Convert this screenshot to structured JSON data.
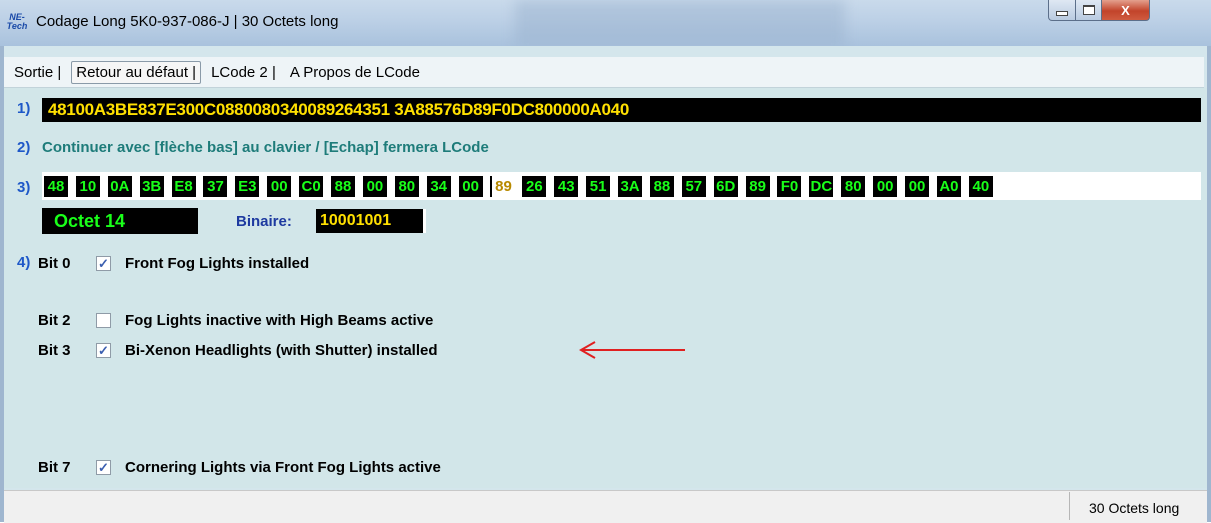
{
  "window": {
    "title": "Codage Long  5K0-937-086-J | 30 Octets long",
    "icon_text_top": "NE-",
    "icon_text_bottom": "Tech",
    "close_glyph": "X"
  },
  "menu": {
    "items": [
      "Sortie |",
      "Retour au défaut |",
      "LCode 2 |",
      "A Propos de LCode"
    ]
  },
  "section1": {
    "num": "1)",
    "hex": "48100A3BE837E300C0880080340089264351 3A88576D89F0DC800000A040"
  },
  "section2": {
    "num": "2)",
    "text": "Continuer avec [flèche bas] au clavier / [Echap] fermera LCode"
  },
  "section3": {
    "num": "3)",
    "bytes": [
      "48",
      "10",
      "0A",
      "3B",
      "E8",
      "37",
      "E3",
      "00",
      "C0",
      "88",
      "00",
      "80",
      "34",
      "00",
      "89",
      "26",
      "43",
      "51",
      "3A",
      "88",
      "57",
      "6D",
      "89",
      "F0",
      "DC",
      "80",
      "00",
      "00",
      "A0",
      "40"
    ],
    "selected_index": 14
  },
  "octet": {
    "label": "Octet 14",
    "bin_label": "Binaire:",
    "bin_value": "10001001"
  },
  "section4": {
    "num": "4)",
    "bits": [
      {
        "name": "Bit 0",
        "checked": true,
        "label": "Front Fog Lights installed"
      },
      {
        "name": "Bit 2",
        "checked": false,
        "label": "Fog Lights inactive with High Beams active"
      },
      {
        "name": "Bit 3",
        "checked": true,
        "label": "Bi-Xenon Headlights (with Shutter) installed"
      },
      {
        "name": "Bit 7",
        "checked": true,
        "label": "Cornering Lights via Front Fog Lights active"
      }
    ]
  },
  "status": {
    "right_text": "30 Octets long"
  },
  "colors": {
    "arrow": "#e02020",
    "hex_text": "#ffe000",
    "byte_text": "#19ff19",
    "panel_bg": "#d2e6e9"
  }
}
